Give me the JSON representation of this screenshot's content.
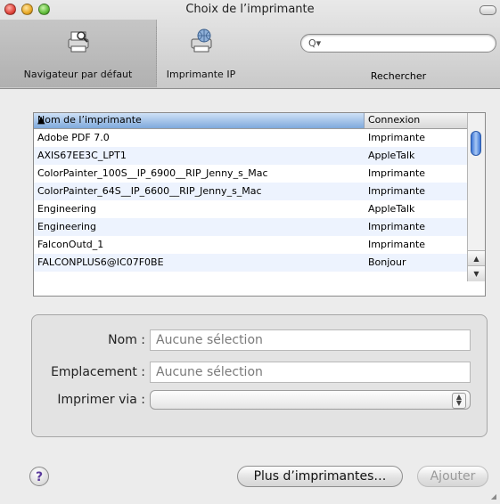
{
  "window": {
    "title": "Choix de l’imprimante"
  },
  "toolbar": {
    "items": [
      {
        "label": "Navigateur par défaut",
        "icon": "default-printer-icon",
        "selected": true
      },
      {
        "label": "Imprimante IP",
        "icon": "ip-printer-icon",
        "selected": false
      }
    ],
    "search": {
      "label": "Rechercher",
      "placeholder": "",
      "icon": "search-icon"
    }
  },
  "printer_list": {
    "columns": [
      "Nom de l’imprimante",
      "Connexion"
    ],
    "sort_column": "Nom de l’imprimante",
    "rows": [
      {
        "name": "Adobe PDF 7.0",
        "connection": "Imprimante"
      },
      {
        "name": "AXIS67EE3C_LPT1",
        "connection": "AppleTalk"
      },
      {
        "name": "ColorPainter_100S__IP_6900__RIP_Jenny_s_Mac",
        "connection": "Imprimante"
      },
      {
        "name": "ColorPainter_64S__IP_6600__RIP_Jenny_s_Mac",
        "connection": "Imprimante"
      },
      {
        "name": "Engineering",
        "connection": "AppleTalk"
      },
      {
        "name": "Engineering",
        "connection": "Imprimante"
      },
      {
        "name": "FalconOutd_1",
        "connection": "Imprimante"
      },
      {
        "name": "FALCONPLUS6@IC07F0BE",
        "connection": "Bonjour"
      }
    ]
  },
  "details": {
    "name_label": "Nom :",
    "name_value": "Aucune sélection",
    "location_label": "Emplacement :",
    "location_value": "Aucune sélection",
    "print_via_label": "Imprimer via :",
    "print_via_value": ""
  },
  "buttons": {
    "help": "?",
    "more_printers": "Plus d’imprimantes…",
    "add": "Ajouter"
  },
  "colors": {
    "header_selected": "#7fa9dc",
    "row_alt": "#edf3fe",
    "scroll_thumb": "#3a74d6"
  }
}
